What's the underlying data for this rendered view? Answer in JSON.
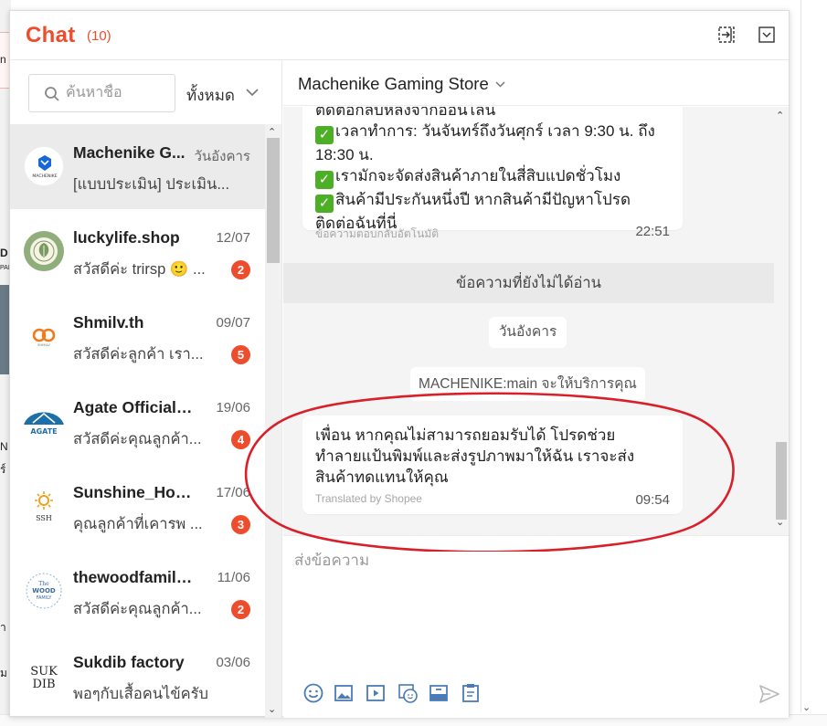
{
  "background": {
    "left_fragments": [
      "n",
      "D",
      "PAE",
      "N",
      "ร์",
      "า",
      "ม"
    ]
  },
  "header": {
    "title": "Chat",
    "unread_count": "(10)"
  },
  "search": {
    "placeholder": "ค้นหาชื่อ",
    "filter_label": "ทั้งหมด"
  },
  "conversations": [
    {
      "name": "Machenike G...",
      "date": "วันอังคาร",
      "preview": "[แบบประเมิน] ประเมิน...",
      "badge": "",
      "active": true
    },
    {
      "name": "luckylife.shop",
      "date": "12/07",
      "preview": "สวัสดีค่ะ trirsp 🙂 ...",
      "badge": "2"
    },
    {
      "name": "Shmilv.th",
      "date": "09/07",
      "preview": "สวัสดีค่ะลูกค้า เรา...",
      "badge": "5"
    },
    {
      "name": "Agate Official ...",
      "date": "19/06",
      "preview": "สวัสดีค่ะคุณลูกค้า...",
      "badge": "4"
    },
    {
      "name": "Sunshine_Hom...",
      "date": "17/06",
      "preview": "คุณลูกค้าที่เคารพ ...",
      "badge": "3"
    },
    {
      "name": "thewoodfamily...",
      "date": "11/06",
      "preview": "สวัสดีค่ะคุณลูกค้า...",
      "badge": "2"
    },
    {
      "name": "Sukdib factory",
      "date": "03/06",
      "preview": "พอๆกับเสื้อคนไข้ครับ",
      "badge": ""
    }
  ],
  "avatar_text": {
    "machenike": "MACHENIKE",
    "shmilv": "SHMILV",
    "agate": "AGATE",
    "sunshine": "SSH",
    "wood": [
      "The",
      "WOOD",
      "FAMILY"
    ],
    "sukdib": [
      "SUK",
      "DIB"
    ]
  },
  "conversation": {
    "shop_name": "Machenike Gaming Store",
    "message1": {
      "lines": [
        {
          "check": false,
          "text": "ติดต่อกลับหลังจากออนไลน์"
        },
        {
          "check": true,
          "text": "เวลาทำการ: วันจันทร์ถึงวันศุกร์ เวลา 9:30 น. ถึง"
        },
        {
          "check": false,
          "text": "18:30 น."
        },
        {
          "check": true,
          "text": "เรามักจะจัดส่งสินค้าภายในสี่สิบแปดชั่วโมง"
        },
        {
          "check": true,
          "text": "สินค้ามีประกันหนึ่งปี หากสินค้ามีปัญหาโปรด"
        },
        {
          "check": false,
          "text": "ติดต่อฉันที่นี่"
        }
      ],
      "meta": "ข้อความตอบกลับอัตโนมัติ",
      "time": "22:51"
    },
    "unread_divider": "ข้อความที่ยังไม่ได้อ่าน",
    "day_label": "วันอังคาร",
    "bot_notice": "MACHENIKE:main จะให้บริการคุณ",
    "message2": {
      "lines": [
        "เพื่อน หากคุณไม่สามารถยอมรับได้ โปรดช่วย",
        "ทำลายแป้นพิมพ์และส่งรูปภาพมาให้ฉัน เราจะส่ง",
        "สินค้าทดแทนให้คุณ"
      ],
      "meta": "Translated by Shopee",
      "time": "09:54"
    },
    "composer_placeholder": "ส่งข้อความ"
  },
  "colors": {
    "brand": "#ee4d2d",
    "annotation": "#d9202a",
    "check": "#4caf26"
  },
  "icons": [
    "expand-icon",
    "collapse-icon",
    "search-icon",
    "chevron-down-icon",
    "emoji-icon",
    "image-icon",
    "video-icon",
    "sticker-icon",
    "product-icon",
    "order-icon",
    "send-icon"
  ]
}
